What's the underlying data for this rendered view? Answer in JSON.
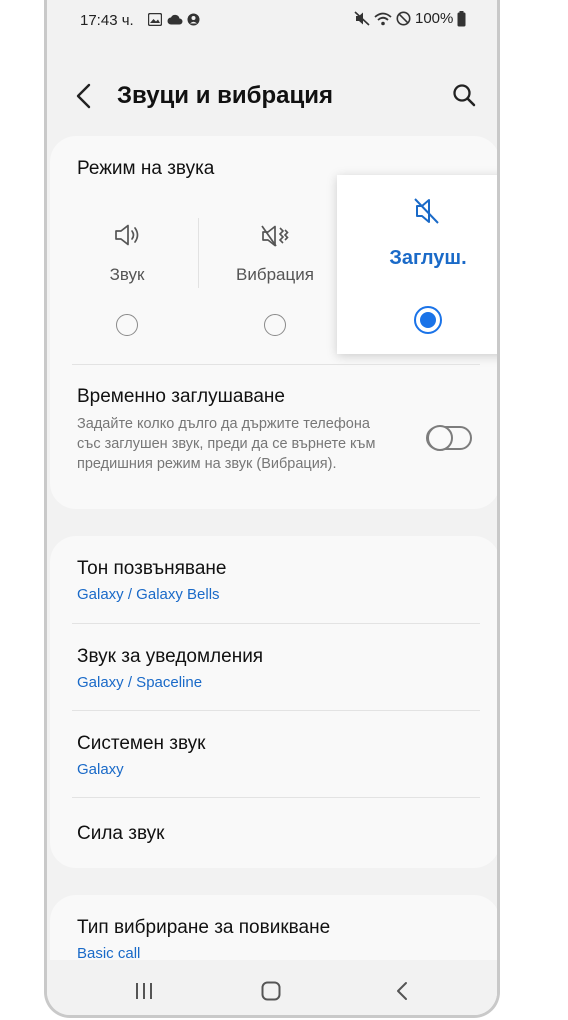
{
  "status_bar": {
    "time": "17:43 ч.",
    "battery": "100%"
  },
  "app_bar": {
    "title": "Звуци и вибрация"
  },
  "sound_mode": {
    "label": "Режим на звука",
    "modes": [
      {
        "label": "Звук",
        "selected": false
      },
      {
        "label": "Вибрация",
        "selected": false
      },
      {
        "label": "Заглуш.",
        "selected": true
      }
    ]
  },
  "temp_mute": {
    "title": "Временно заглушаване",
    "description": "Задайте колко дълго да държите телефона със заглушен звук, преди да се върнете към предишния режим на звук (Вибрация).",
    "enabled": false
  },
  "settings": [
    {
      "title": "Тон позвъняване",
      "subtitle": "Galaxy / Galaxy Bells"
    },
    {
      "title": "Звук за уведомления",
      "subtitle": "Galaxy / Spaceline"
    },
    {
      "title": "Системен звук",
      "subtitle": "Galaxy"
    },
    {
      "title": "Сила звук"
    }
  ],
  "vibration": {
    "title": "Тип вибриране за повикване",
    "subtitle": "Basic call"
  },
  "colors": {
    "accent": "#1a73e8",
    "link": "#1a6ac8",
    "background": "#f2f2f2",
    "card": "#f9f9f9"
  },
  "icons": [
    "back-arrow-icon",
    "search-icon",
    "speaker-icon",
    "vibrate-icon",
    "mute-icon",
    "recent-apps-icon",
    "home-icon",
    "nav-back-icon"
  ]
}
